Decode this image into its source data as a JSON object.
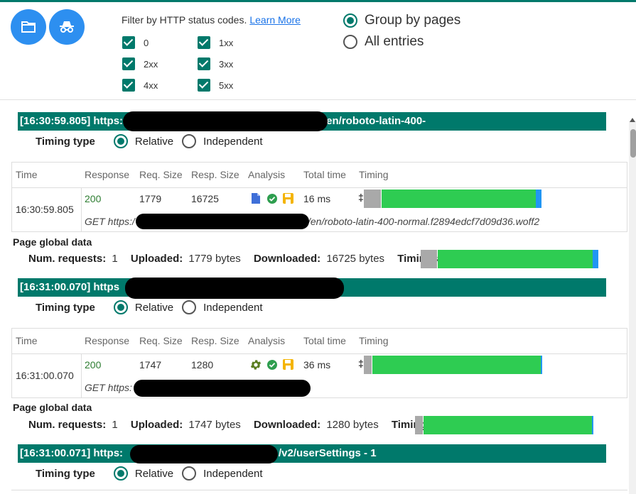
{
  "filter": {
    "title": "Filter by HTTP status codes.",
    "learn_more": "Learn More",
    "codes": [
      "0",
      "1xx",
      "2xx",
      "3xx",
      "4xx",
      "5xx"
    ]
  },
  "grouping": {
    "group_by_pages": "Group by pages",
    "all_entries": "All entries",
    "selected": "Group by pages"
  },
  "timing_type": {
    "label": "Timing type",
    "relative": "Relative",
    "independent": "Independent"
  },
  "table_headers": [
    "Time",
    "Response",
    "Req. Size",
    "Resp. Size",
    "Analysis",
    "Total time",
    "Timing"
  ],
  "pages": [
    {
      "banner_left": "[16:30:59.805] https:",
      "banner_right": "/en/roboto-latin-400-",
      "entry": {
        "time": "16:30:59.805",
        "response": "200",
        "req_size": "1779",
        "resp_size": "16725",
        "total_time": "16 ms",
        "get_left": "GET https:/",
        "get_right": "/en/roboto-latin-400-normal.f2894edcf7d09d36.woff2",
        "analysis_icons": [
          "file-icon",
          "check-circle-icon",
          "save-icon"
        ]
      },
      "global": {
        "title": "Page global data",
        "num_requests_label": "Num. requests:",
        "num_requests": "1",
        "uploaded_label": "Uploaded:",
        "uploaded": "1779 bytes",
        "downloaded_label": "Downloaded:",
        "downloaded": "16725 bytes",
        "timings_label": "Timings:"
      }
    },
    {
      "banner_left": "[16:31:00.070] https",
      "banner_right": "",
      "entry": {
        "time": "16:31:00.070",
        "response": "200",
        "req_size": "1747",
        "resp_size": "1280",
        "total_time": "36 ms",
        "get_left": "GET https:",
        "get_right": "",
        "analysis_icons": [
          "gear-icon",
          "check-circle-icon",
          "save-icon"
        ]
      },
      "global": {
        "title": "Page global data",
        "num_requests_label": "Num. requests:",
        "num_requests": "1",
        "uploaded_label": "Uploaded:",
        "uploaded": "1747 bytes",
        "downloaded_label": "Downloaded:",
        "downloaded": "1280 bytes",
        "timings_label": "Timings:"
      }
    },
    {
      "banner_left": "[16:31:00.071] https:",
      "banner_right": "/v2/userSettings - 1"
    }
  ],
  "colors": {
    "accent": "#00796b",
    "blocked": "#a9a9a9",
    "wait": "#2ecc52",
    "receive": "#2196f3",
    "button": "#2d8ff0"
  }
}
